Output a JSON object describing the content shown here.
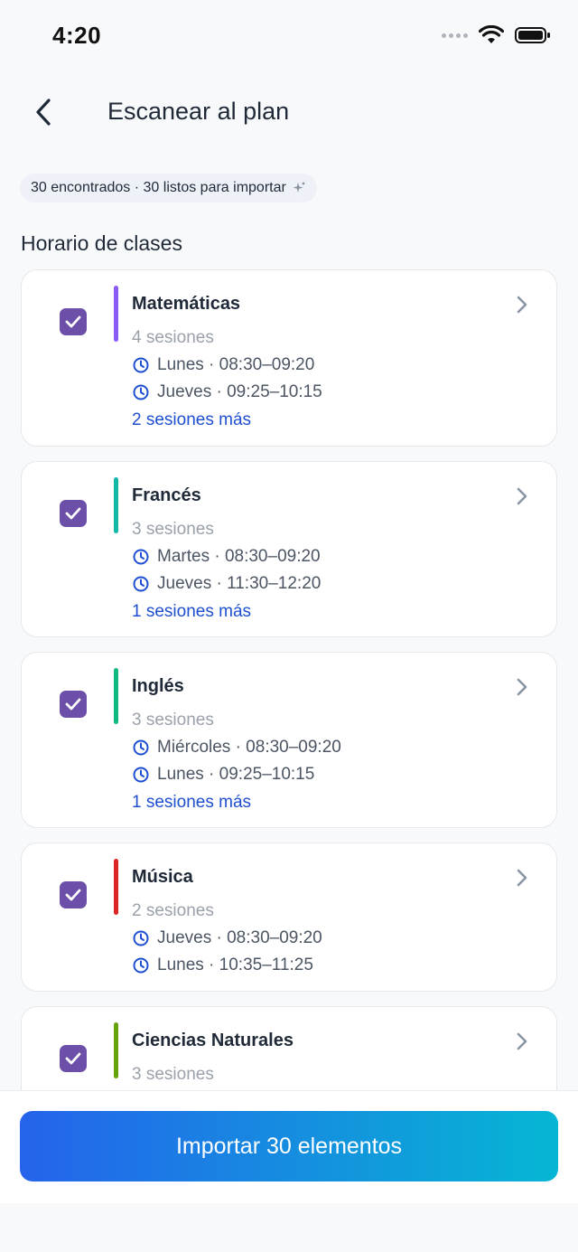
{
  "status_bar": {
    "time": "4:20"
  },
  "header": {
    "title": "Escanear al plan",
    "back_icon": "chevron-left-icon"
  },
  "summary": {
    "text": "30 encontrados · 30 listos para importar",
    "icon": "sparkle-icon"
  },
  "section": {
    "title": "Horario de clases"
  },
  "colors": {
    "accent_purple": "#6b4fa8",
    "link_blue": "#1f4fd1",
    "gradient_start": "#2563eb",
    "gradient_end": "#06b6d4"
  },
  "classes": [
    {
      "name": "Matemáticas",
      "count": "4 sesiones",
      "color": "#8b5cf6",
      "sessions": [
        "Lunes · 08:30–09:20",
        "Jueves · 09:25–10:15"
      ],
      "more": "2 sesiones más",
      "checked": true
    },
    {
      "name": "Francés",
      "count": "3 sesiones",
      "color": "#14b8a6",
      "sessions": [
        "Martes · 08:30–09:20",
        "Jueves · 11:30–12:20"
      ],
      "more": "1 sesiones más",
      "checked": true
    },
    {
      "name": "Inglés",
      "count": "3 sesiones",
      "color": "#10b981",
      "sessions": [
        "Miércoles · 08:30–09:20",
        "Lunes · 09:25–10:15"
      ],
      "more": "1 sesiones más",
      "checked": true
    },
    {
      "name": "Música",
      "count": "2 sesiones",
      "color": "#dc2626",
      "sessions": [
        "Jueves · 08:30–09:20",
        "Lunes · 10:35–11:25"
      ],
      "more": "",
      "checked": true
    },
    {
      "name": "Ciencias Naturales",
      "count": "3 sesiones",
      "color": "#65a30d",
      "sessions": [],
      "more": "",
      "checked": true
    }
  ],
  "footer": {
    "import_label": "Importar 30 elementos"
  }
}
